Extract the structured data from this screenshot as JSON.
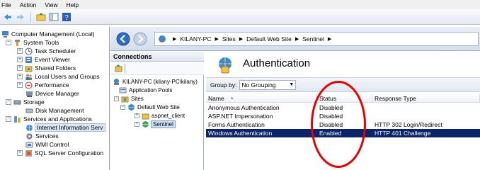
{
  "menu": {
    "items": [
      "File",
      "Action",
      "View",
      "Help"
    ]
  },
  "toolbar": {
    "icons": [
      "back-arrow-icon",
      "forward-arrow-icon",
      "up-folder-icon",
      "show-hide-tree-icon",
      "help-icon"
    ]
  },
  "tree": {
    "root": "Computer Management (Local)",
    "system_tools": "System Tools",
    "task_scheduler": "Task Scheduler",
    "event_viewer": "Event Viewer",
    "shared_folders": "Shared Folders",
    "local_users": "Local Users and Groups",
    "performance": "Performance",
    "device_manager": "Device Manager",
    "storage": "Storage",
    "disk_management": "Disk Management",
    "services_apps": "Services and Applications",
    "iis": "Internet Information Serv",
    "services": "Services",
    "wmi": "WMI Control",
    "sql": "SQL Server Configuration"
  },
  "address": {
    "crumbs": [
      "KILANY-PC",
      "Sites",
      "Default Web Site",
      "Sentinel"
    ]
  },
  "connections": {
    "header": "Connections",
    "server": "KILANY-PC (kilany-PC\\kilany)",
    "app_pools": "Application Pools",
    "sites": "Sites",
    "default_site": "Default Web Site",
    "aspnet_client": "aspnet_client",
    "sentinel": "Sentinel"
  },
  "feature": {
    "title": "Authentication",
    "group_by_label": "Group by:",
    "group_by_value": "No Grouping",
    "columns": {
      "name": "Name",
      "status": "Status",
      "response": "Response Type"
    },
    "rows": [
      {
        "name": "Anonymous Authentication",
        "status": "Disabled",
        "response": ""
      },
      {
        "name": "ASP.NET Impersonation",
        "status": "Disabled",
        "response": ""
      },
      {
        "name": "Forms Authentication",
        "status": "Disabled",
        "response": "HTTP 302 Login/Redirect"
      },
      {
        "name": "Windows Authentication",
        "status": "Enabled",
        "response": "HTTP 401 Challenge"
      }
    ]
  },
  "colors": {
    "selection": "#0a246a",
    "annotation_circle": "#e60000",
    "header_gradient": "#dfe6f0"
  }
}
